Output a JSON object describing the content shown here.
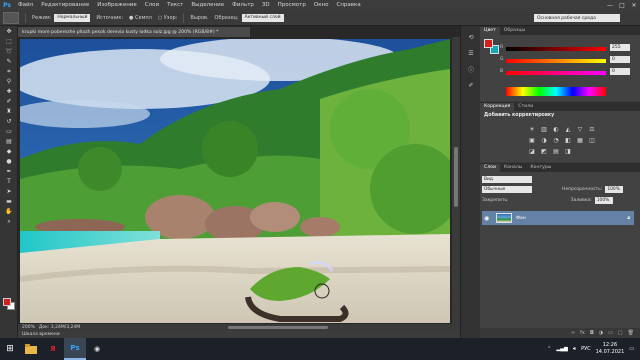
{
  "app": {
    "logo": "Ps"
  },
  "menu": [
    "Файл",
    "Редактирование",
    "Изображение",
    "Слои",
    "Текст",
    "Выделение",
    "Фильтр",
    "3D",
    "Просмотр",
    "Окно",
    "Справка"
  ],
  "window_controls": [
    "—",
    "□",
    "✕"
  ],
  "options": {
    "mode_label": "Режим:",
    "mode_value": "Нормальный",
    "source_label": "Источник:",
    "source_sample": "● Семпл",
    "source_pattern": "○ Узор:",
    "align_label": "Выров.",
    "sample_label": "Образец:",
    "sample_value": "Активный слой",
    "workspace_value": "Основная рабочая среда"
  },
  "document": {
    "tab_title": "krupki more poberezhe pliazh pesok derevia kusty lodka solz.jpg @ 200% (RGB/8#) *",
    "zoom": "200%",
    "doc_size": "Док: 3,24M/3,24M",
    "timeline_label": "Шкала времени"
  },
  "panels": {
    "color_tabs": [
      "Цвет",
      "Образцы"
    ],
    "rgb": [
      {
        "label": "R",
        "value": "255"
      },
      {
        "label": "G",
        "value": "0"
      },
      {
        "label": "B",
        "value": "0"
      }
    ],
    "adjustment_tabs": [
      "Коррекция",
      "Стили"
    ],
    "adjustment_title": "Добавить корректировку",
    "adjustment_icons": [
      "☀",
      "▥",
      "◐",
      "◭",
      "▽",
      "⚖",
      "▣",
      "◑",
      "◔",
      "◧",
      "▦",
      "◫",
      "◪",
      "◩",
      "▤",
      "◨"
    ],
    "layers_tabs": [
      "Слои",
      "Каналы",
      "Контуры"
    ],
    "layers_kind": "Вид",
    "blend_mode": "Обычные",
    "opacity_label": "Непрозрачность:",
    "opacity_value": "100%",
    "lock_label": "Закрепить:",
    "fill_label": "Заливка:",
    "fill_value": "100%",
    "layer_name": "Фон"
  },
  "taskbar": {
    "apps": [
      "Я",
      "Ps",
      "◉"
    ],
    "lang": "РУС",
    "time": "12:26",
    "date": "14.07.2021"
  },
  "colors": {
    "foreground": "#d3201f",
    "background": "#11a7b5",
    "layer_selected": "#6482a5"
  }
}
